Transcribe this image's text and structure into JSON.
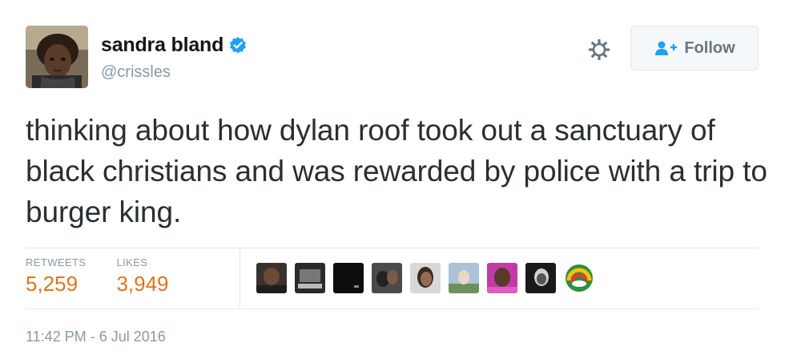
{
  "tweet": {
    "display_name": "sandra bland",
    "handle": "@crissles",
    "verified": true,
    "text": "thinking about how dylan roof took out a sanctuary of black christians and was rewarded by police with a trip to burger king.",
    "timestamp": "11:42 PM - 6 Jul 2016"
  },
  "actions": {
    "follow_label": "Follow",
    "settings_icon": "gear-icon",
    "follow_icon": "add-user-icon"
  },
  "stats": {
    "retweets_label": "RETWEETS",
    "retweets_value": "5,259",
    "likes_label": "LIKES",
    "likes_value": "3,949"
  },
  "colors": {
    "verified_blue": "#1da1f2",
    "stat_value_orange": "#e0751d",
    "muted_text": "#8899a6",
    "divider": "#e1e8ed"
  }
}
